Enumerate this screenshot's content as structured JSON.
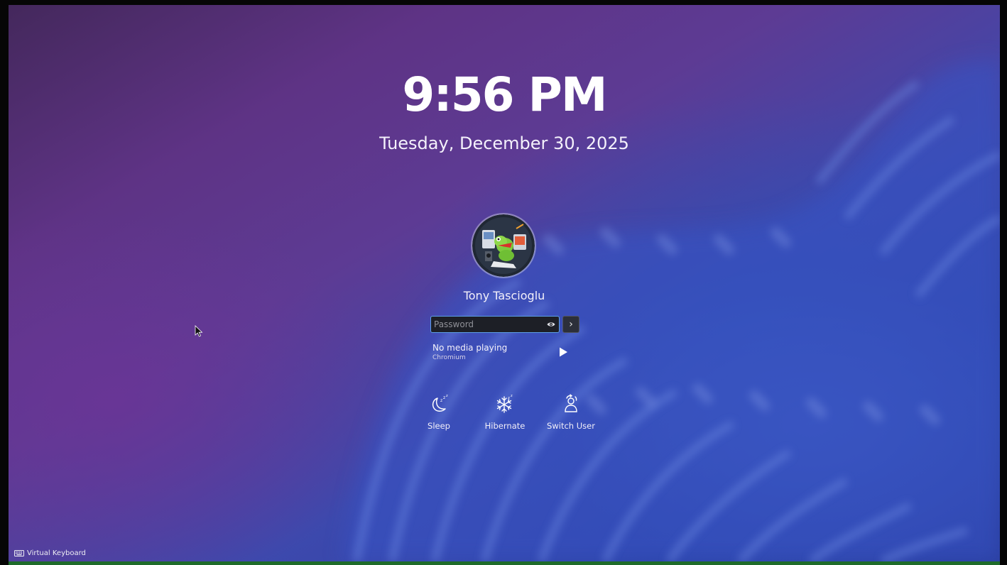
{
  "clock": {
    "time": "9:56 PM",
    "date": "Tuesday, December 30, 2025"
  },
  "user": {
    "name": "Tony Tascioglu",
    "avatar_icon": "konqi-avatar"
  },
  "login": {
    "password_placeholder": "Password",
    "password_value": "",
    "reveal_icon": "eye-icon",
    "submit_label": "›"
  },
  "media": {
    "title": "No media playing",
    "source": "Chromium",
    "play_icon": "play-icon"
  },
  "actions": [
    {
      "label": "Sleep",
      "icon": "moon-sleep-icon"
    },
    {
      "label": "Hibernate",
      "icon": "snowflake-icon"
    },
    {
      "label": "Switch User",
      "icon": "switch-user-icon"
    }
  ],
  "footer": {
    "virtual_keyboard_label": "Virtual Keyboard",
    "keyboard_icon": "keyboard-icon"
  },
  "colors": {
    "field_border": "#5d9fe8",
    "field_background": "#1d1f26",
    "text": "#ffffff"
  }
}
